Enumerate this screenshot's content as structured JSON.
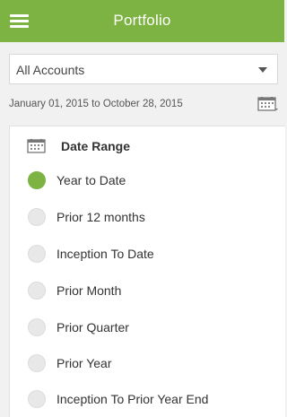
{
  "header": {
    "title": "Portfolio",
    "menu_icon": "hamburger-menu-icon"
  },
  "account_select": {
    "value": "All Accounts",
    "caret_icon": "caret-down-icon"
  },
  "date_range_text": "January 01, 2015 to October 28, 2015",
  "panel": {
    "title": "Date Range",
    "options": [
      {
        "label": "Year to Date",
        "selected": true
      },
      {
        "label": "Prior 12 months",
        "selected": false
      },
      {
        "label": "Inception To Date",
        "selected": false
      },
      {
        "label": "Prior Month",
        "selected": false
      },
      {
        "label": "Prior Quarter",
        "selected": false
      },
      {
        "label": "Prior Year",
        "selected": false
      },
      {
        "label": "Inception To Prior Year End",
        "selected": false
      }
    ]
  },
  "colors": {
    "accent": "#7cb342",
    "background": "#f1f1f1"
  }
}
